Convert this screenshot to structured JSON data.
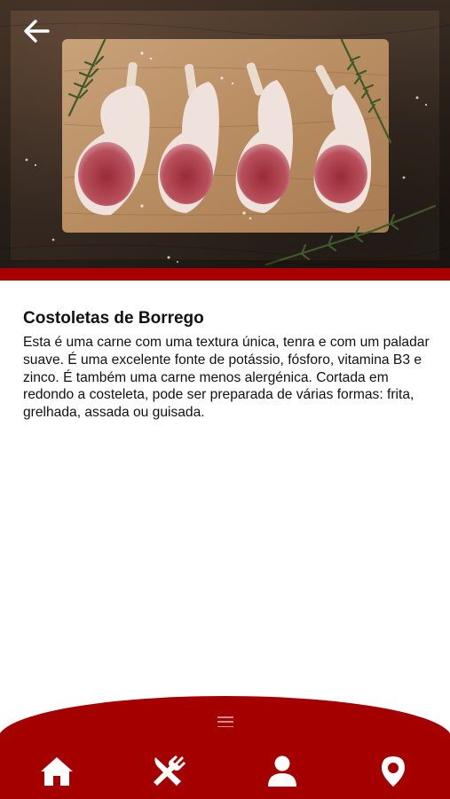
{
  "product": {
    "title": "Costoletas de Borrego",
    "description": "Esta é uma carne com uma textura única, tenra e com um paladar suave. É uma excelente fonte de potássio, fósforo, vitamina B3 e zinco. É também uma carne menos alergénica. Cortada em redondo a costeleta, pode ser preparada de várias formas: frita, grelhada, assada ou guisada."
  },
  "header": {
    "back_icon": "arrow-left-icon"
  },
  "hero": {
    "image_subject": "lamb-chops-on-wooden-board"
  },
  "bottom_nav": {
    "handle_icon": "drag-handle-icon",
    "items": [
      {
        "name": "home",
        "icon": "home-icon"
      },
      {
        "name": "menu",
        "icon": "fork-knife-icon"
      },
      {
        "name": "profile",
        "icon": "user-icon"
      },
      {
        "name": "location",
        "icon": "map-pin-icon"
      }
    ]
  },
  "colors": {
    "brand_red": "#a50000",
    "text": "#111111",
    "background": "#ffffff",
    "icon": "#ffffff"
  }
}
